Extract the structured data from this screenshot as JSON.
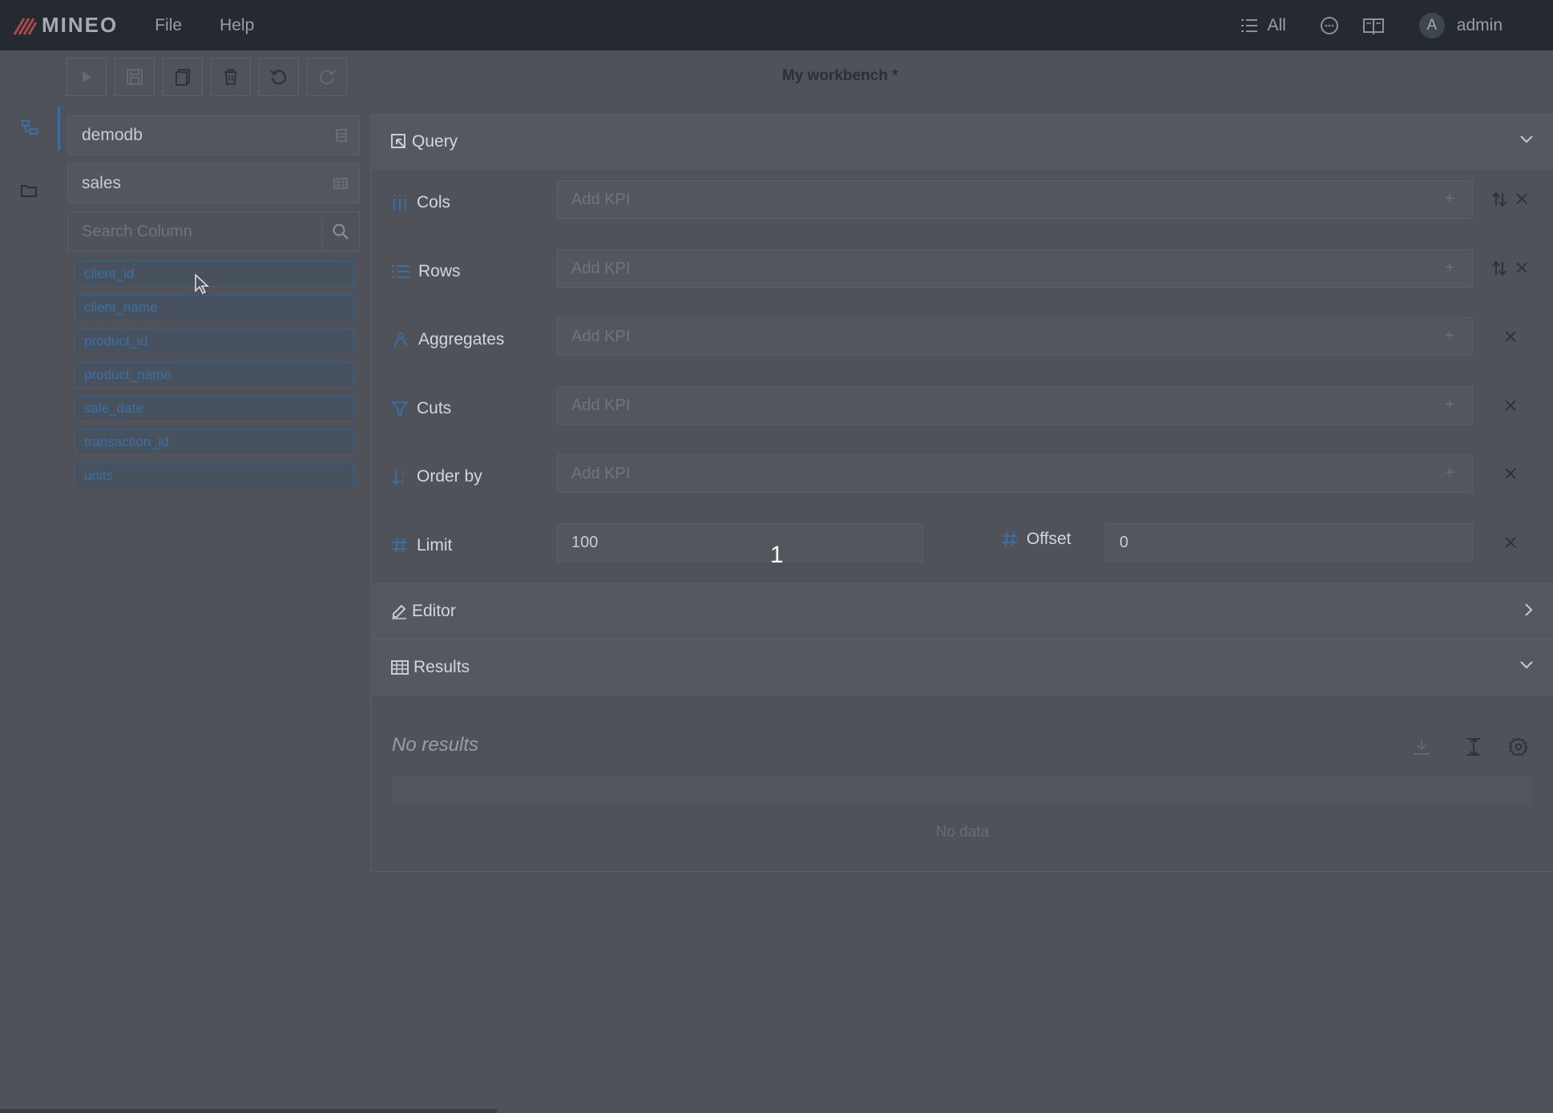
{
  "app": {
    "logo_text": "MINEO",
    "menu": [
      "File",
      "Help"
    ],
    "filter_label": "All",
    "user": {
      "avatar_letter": "A",
      "name": "admin"
    }
  },
  "toolbar": {
    "buttons": [
      "run-icon",
      "save-icon",
      "copy-icon",
      "trash-icon",
      "undo-icon",
      "redo-icon"
    ],
    "title": "My workbench *"
  },
  "sidebar": {
    "database": "demodb",
    "table": "sales",
    "search_placeholder": "Search Column",
    "columns": [
      "client_id",
      "client_name",
      "product_id",
      "product_name",
      "sale_date",
      "transaction_id",
      "units"
    ]
  },
  "query": {
    "title": "Query",
    "placeholder": "Add KPI",
    "rows": [
      {
        "label": "Cols"
      },
      {
        "label": "Rows"
      },
      {
        "label": "Aggregates"
      },
      {
        "label": "Cuts"
      },
      {
        "label": "Order by"
      }
    ],
    "limit": {
      "label": "Limit",
      "value": "100"
    },
    "offset": {
      "label": "Offset",
      "value": "0"
    }
  },
  "editor": {
    "title": "Editor"
  },
  "results": {
    "title": "Results",
    "empty_text": "No results",
    "no_data": "No data"
  },
  "overlay": {
    "step_number": "1"
  },
  "colors": {
    "accent": "#3a6fa4",
    "topbar": "#252a31",
    "background": "#4f5259"
  }
}
